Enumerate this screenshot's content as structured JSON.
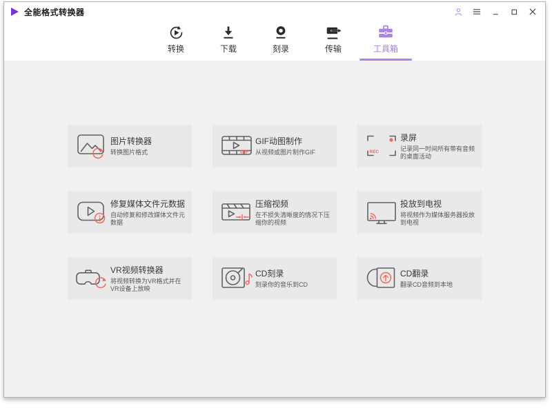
{
  "window": {
    "title": "全能格式转换器",
    "controls": {
      "account": "person-icon",
      "menu": "hamburger-icon",
      "minimize": "minimize-icon",
      "maximize": "maximize-icon",
      "close": "close-icon"
    }
  },
  "nav": {
    "tabs": [
      {
        "label": "转换",
        "icon": "convert-icon",
        "active": false
      },
      {
        "label": "下载",
        "icon": "download-icon",
        "active": false
      },
      {
        "label": "刻录",
        "icon": "burn-icon",
        "active": false
      },
      {
        "label": "传输",
        "icon": "transfer-icon",
        "active": false
      },
      {
        "label": "工具箱",
        "icon": "toolbox-icon",
        "active": true
      }
    ]
  },
  "toolbox": {
    "cards": [
      {
        "title": "图片转换器",
        "desc": "转换图片格式",
        "icon": "image-converter-icon"
      },
      {
        "title": "GIF动图制作",
        "desc": "从视频或图片制作GIF",
        "icon": "gif-maker-icon"
      },
      {
        "title": "录屏",
        "desc": "记录同一时间所有带有音频的桌面活动",
        "icon": "screen-record-icon"
      },
      {
        "title": "修复媒体文件元数据",
        "desc": "自动修复和修改媒体文件元数据",
        "icon": "fix-metadata-icon"
      },
      {
        "title": "压缩视频",
        "desc": "在不损失清晰度的情况下压缩你的视频",
        "icon": "compress-video-icon"
      },
      {
        "title": "投放到电视",
        "desc": "将视频作为媒体服务器投放到电视",
        "icon": "cast-tv-icon"
      },
      {
        "title": "VR视频转换器",
        "desc": "将视频转换为VR格式并在VR设备上放映",
        "icon": "vr-converter-icon"
      },
      {
        "title": "CD刻录",
        "desc": "刻录你的音乐到CD",
        "icon": "cd-burn-icon"
      },
      {
        "title": "CD翻录",
        "desc": "翻录CD音频到本地",
        "icon": "cd-rip-icon"
      }
    ]
  },
  "colors": {
    "accent_purple": "#a57ee8",
    "logo_purple": "#7335cb",
    "accent_coral": "#f2695c",
    "content_bg": "#f1f1f2",
    "card_bg": "#e9e9ea"
  }
}
